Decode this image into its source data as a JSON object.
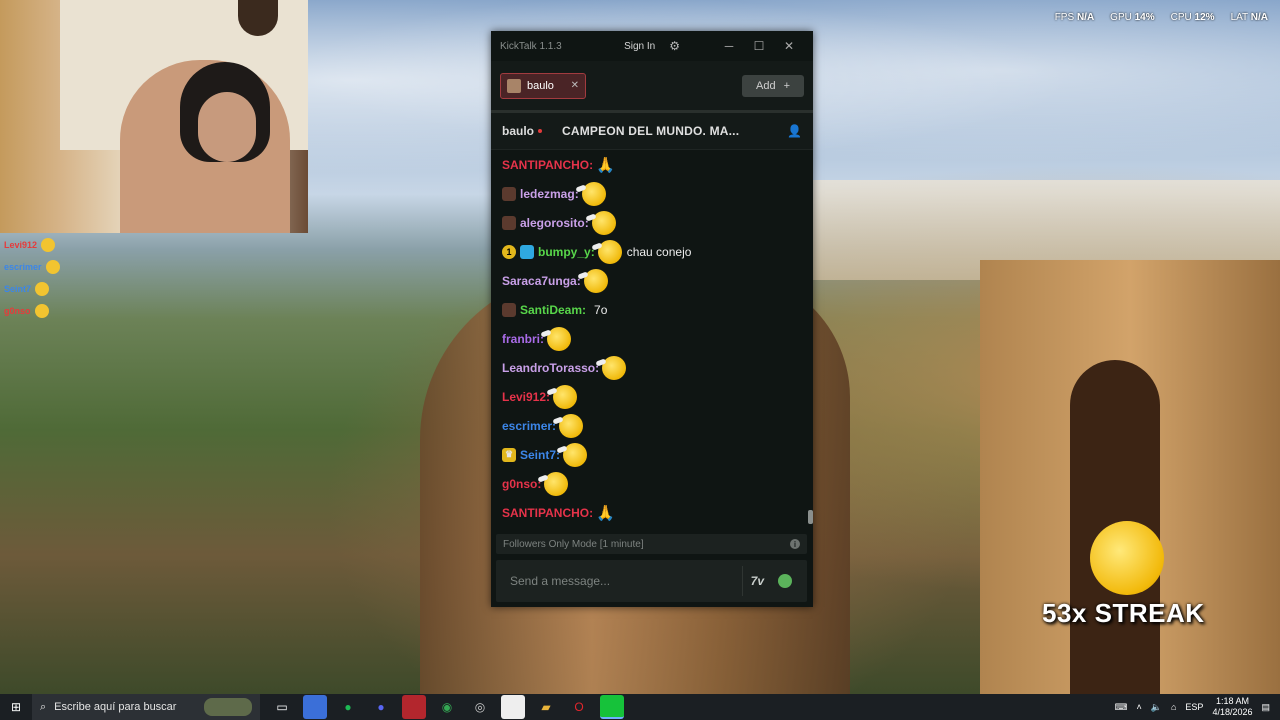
{
  "hardware": {
    "fps_label": "FPS",
    "fps_value": "N/A",
    "gpu_label": "GPU",
    "gpu_value": "14%",
    "cpu_label": "CPU",
    "cpu_value": "12%",
    "lat_label": "LAT",
    "lat_value": "N/A"
  },
  "overlay_chat": [
    {
      "name": "Levi912",
      "color": "#e63b3b"
    },
    {
      "name": "escrimer",
      "color": "#3c86e8"
    },
    {
      "name": "Seint7",
      "color": "#3c86e8"
    },
    {
      "name": "g0nso",
      "color": "#e63b3b"
    }
  ],
  "window": {
    "title": "KickTalk 1.1.3",
    "sign_in": "Sign In",
    "minimize": "─",
    "maximize": "☐",
    "close": "✕"
  },
  "tabs": {
    "items": [
      {
        "label": "baulo"
      }
    ],
    "add_label": "Add",
    "add_icon": "+"
  },
  "channel": {
    "name": "baulo",
    "stream_title": "CAMPEON DEL MUNDO. MA..."
  },
  "messages": [
    {
      "user": "SANTIPANCHO",
      "color": "#e6334a",
      "badges": [],
      "emote": "pray",
      "text": ""
    },
    {
      "user": "ledezmag",
      "color": "#c9a0e8",
      "badges": [
        "gift"
      ],
      "emote": "face",
      "text": ""
    },
    {
      "user": "alegorosito",
      "color": "#c9a0e8",
      "badges": [
        "gift"
      ],
      "emote": "face",
      "text": ""
    },
    {
      "user": "bumpy_y",
      "color": "#58d64a",
      "badges": [
        "one",
        "cube"
      ],
      "emote": "face",
      "text": "chau conejo"
    },
    {
      "user": "Saraca7unga",
      "color": "#c9a0e8",
      "badges": [],
      "emote": "face",
      "text": ""
    },
    {
      "user": "SantiDeam",
      "color": "#58d64a",
      "badges": [
        "gift"
      ],
      "emote": "",
      "text": "7o"
    },
    {
      "user": "franbri",
      "color": "#a96be8",
      "badges": [],
      "emote": "face",
      "text": ""
    },
    {
      "user": "LeandroTorasso",
      "color": "#c9a0e8",
      "badges": [],
      "emote": "face",
      "text": ""
    },
    {
      "user": "Levi912",
      "color": "#e6334a",
      "badges": [],
      "emote": "face",
      "text": ""
    },
    {
      "user": "escrimer",
      "color": "#3c86e8",
      "badges": [],
      "emote": "face",
      "text": ""
    },
    {
      "user": "Seint7",
      "color": "#3c86e8",
      "badges": [
        "crown"
      ],
      "emote": "face",
      "text": ""
    },
    {
      "user": "g0nso",
      "color": "#e6334a",
      "badges": [],
      "emote": "face",
      "text": ""
    },
    {
      "user": "SANTIPANCHO",
      "color": "#e6334a",
      "badges": [],
      "emote": "pray",
      "text": ""
    }
  ],
  "chat_mode": "Followers Only Mode [1 minute]",
  "input": {
    "placeholder": "Send a message..."
  },
  "streak": {
    "text": "53x STREAK"
  },
  "taskbar": {
    "search_placeholder": "Escribe aquí para buscar",
    "language": "ESP",
    "time": "1:18 AM",
    "date": "4/18/2026"
  }
}
